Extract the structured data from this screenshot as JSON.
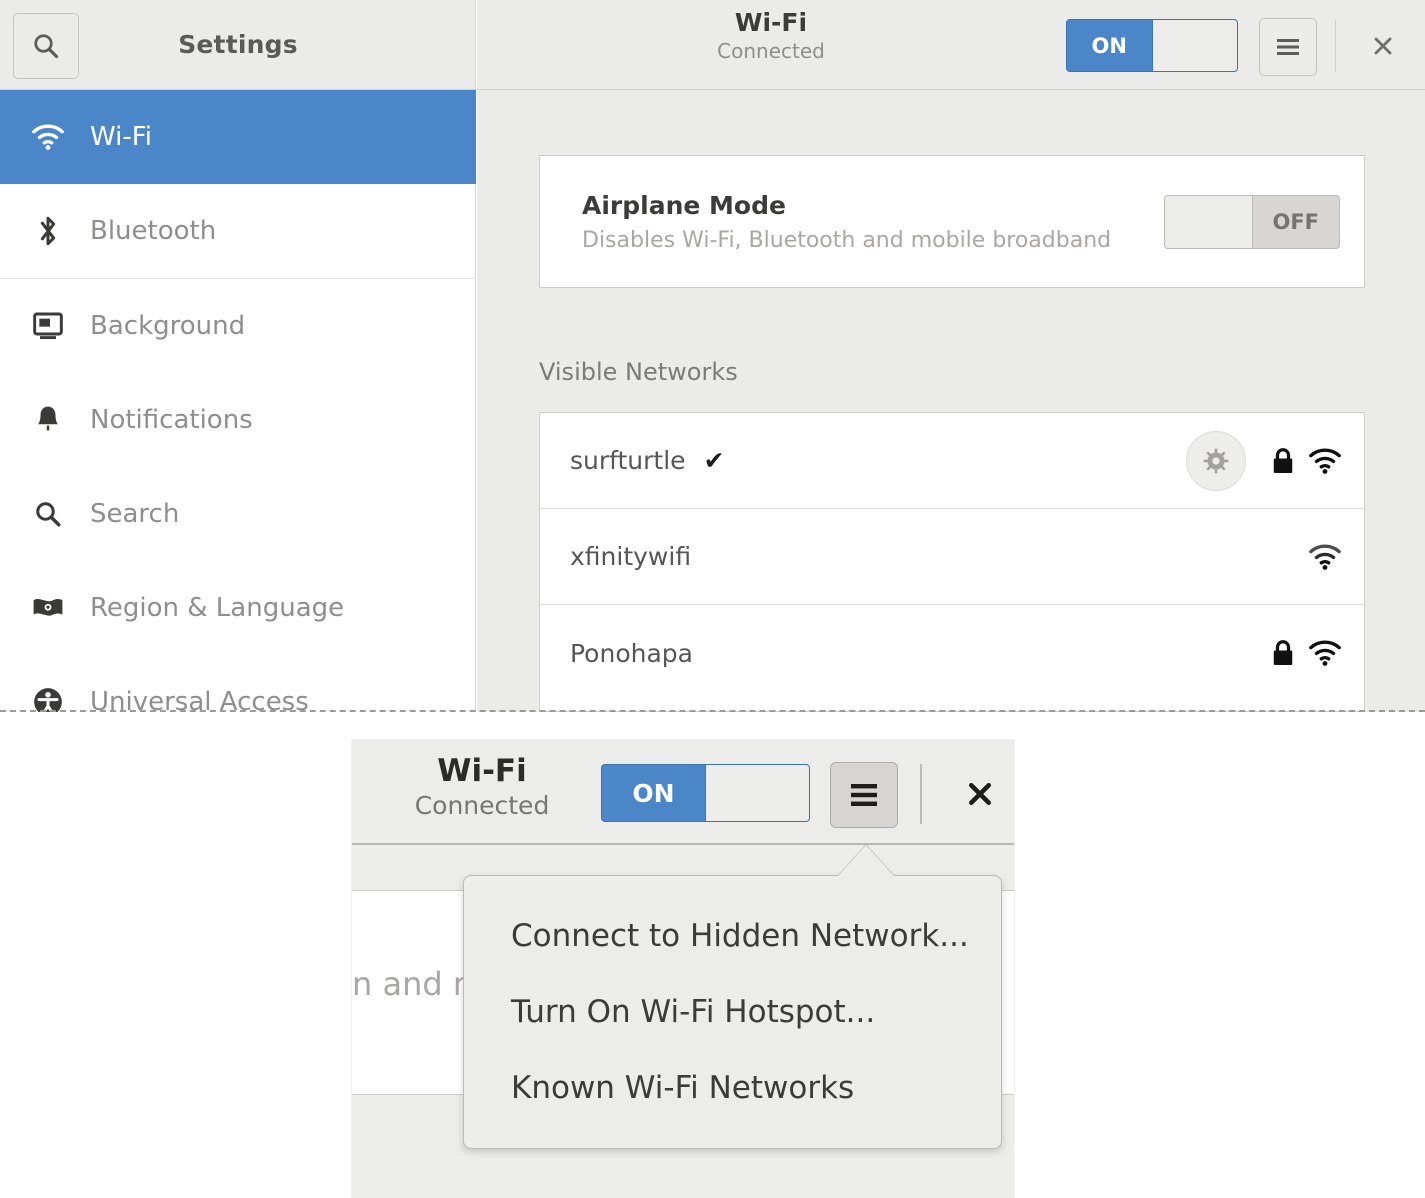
{
  "sidebar": {
    "title": "Settings",
    "search_icon": "search-icon",
    "items": [
      {
        "label": "Wi-Fi",
        "icon": "wifi-icon",
        "selected": true
      },
      {
        "label": "Bluetooth",
        "icon": "bluetooth-icon",
        "selected": false
      },
      {
        "label": "Background",
        "icon": "background-icon",
        "selected": false
      },
      {
        "label": "Notifications",
        "icon": "bell-icon",
        "selected": false
      },
      {
        "label": "Search",
        "icon": "search-icon",
        "selected": false
      },
      {
        "label": "Region & Language",
        "icon": "flag-icon",
        "selected": false
      },
      {
        "label": "Universal Access",
        "icon": "accessibility-icon",
        "selected": false
      }
    ]
  },
  "header": {
    "title": "Wi-Fi",
    "subtitle": "Connected",
    "toggle": {
      "state": "on",
      "label": "ON"
    },
    "menu_icon": "hamburger-icon",
    "close_icon": "close-icon"
  },
  "airplane": {
    "title": "Airplane Mode",
    "description": "Disables Wi-Fi, Bluetooth and mobile broadband",
    "toggle": {
      "state": "off",
      "label": "OFF"
    }
  },
  "networks": {
    "section_label": "Visible Networks",
    "rows": [
      {
        "name": "surfturtle",
        "connected_check": "✔",
        "has_settings": true,
        "has_lock": true,
        "signal": "wifi-icon"
      },
      {
        "name": "xfinitywifi",
        "connected_check": "",
        "has_settings": false,
        "has_lock": false,
        "signal": "wifi-icon"
      },
      {
        "name": "Ponohapa",
        "connected_check": "",
        "has_settings": false,
        "has_lock": true,
        "signal": "wifi-icon"
      }
    ]
  },
  "overlay": {
    "title": "Wi-Fi",
    "subtitle": "Connected",
    "toggle": {
      "state": "on",
      "label": "ON"
    },
    "menu_icon": "hamburger-icon",
    "close_icon": "close-icon",
    "partial_text": "n and mo",
    "menu_items": [
      "Connect to Hidden Network...",
      "Turn On Wi-Fi Hotspot...",
      "Known Wi-Fi Networks"
    ]
  },
  "colors": {
    "accent_blue": "#4a86c8",
    "panel_grey": "#ebebe9",
    "border_grey": "#cfcdc9",
    "text_dark": "#3b3b39",
    "text_muted": "#8e8e8c"
  }
}
